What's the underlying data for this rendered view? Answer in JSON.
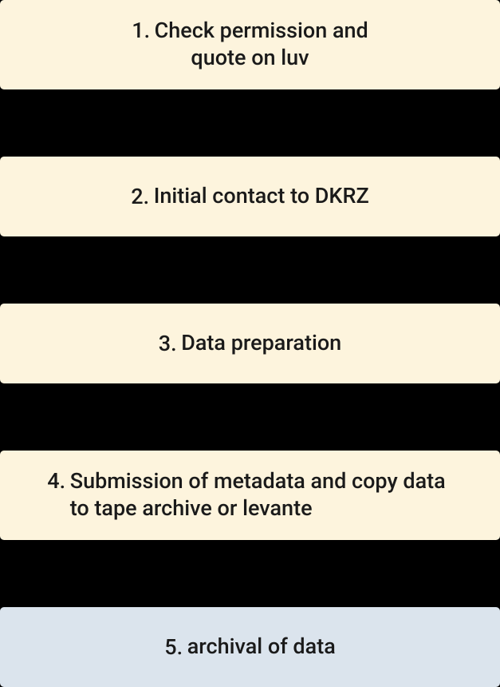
{
  "steps": [
    {
      "number": "1.",
      "label_line1": "Check permission and",
      "label_line2": "quote on luv"
    },
    {
      "number": "2.",
      "label": "Initial contact to DKRZ"
    },
    {
      "number": "3.",
      "label": "Data preparation"
    },
    {
      "number": "4.",
      "label": "Submission of metadata and copy data to tape archive or levante"
    },
    {
      "number": "5.",
      "label": "archival of data"
    }
  ]
}
